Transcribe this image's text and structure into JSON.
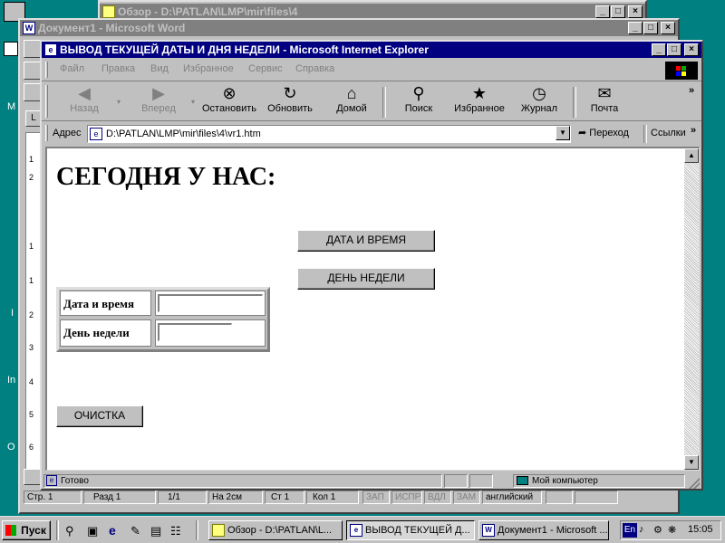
{
  "explorer_window": {
    "title": "Обзор - D:\\PATLAN\\LMP\\mir\\files\\4"
  },
  "word_window": {
    "title": "Документ1 - Microsoft Word",
    "status": {
      "page": "Стр. 1",
      "section": "Разд 1",
      "pages": "1/1",
      "position": "На 2см",
      "line": "Ст 1",
      "column": "Кол 1",
      "rec": "ЗАП",
      "trk": "ИСПР",
      "ext": "ВДЛ",
      "ovr": "ЗАМ",
      "language": "английский"
    },
    "ruler": [
      "1",
      "2",
      "1",
      "1",
      "2",
      "3",
      "4",
      "5",
      "6"
    ]
  },
  "ie_window": {
    "title": "ВЫВОД ТЕКУЩЕЙ ДАТЫ И ДНЯ НЕДЕЛИ - Microsoft Internet Explorer",
    "menu": [
      "Файл",
      "Правка",
      "Вид",
      "Избранное",
      "Сервис",
      "Справка"
    ],
    "toolbar": {
      "back": "Назад",
      "forward": "Вперед",
      "stop": "Остановить",
      "refresh": "Обновить",
      "home": "Домой",
      "search": "Поиск",
      "favorites": "Избранное",
      "history": "Журнал",
      "mail": "Почта"
    },
    "address": {
      "label": "Адрес",
      "value": "D:\\PATLAN\\LMP\\mir\\files\\4\\vr1.htm",
      "go": "Переход",
      "links": "Ссылки"
    },
    "page": {
      "heading": "СЕГОДНЯ У НАС:",
      "btn_datetime": "ДАТА И ВРЕМЯ",
      "btn_weekday": "ДЕНЬ НЕДЕЛИ",
      "row1_label": "Дата и время",
      "row1_value": "",
      "row2_label": "День недели",
      "row2_value": "",
      "btn_clear": "ОЧИСТКА"
    },
    "status": {
      "text": "Готово",
      "zone": "Мой компьютер"
    }
  },
  "taskbar": {
    "start": "Пуск",
    "tasks": [
      "Обзор - D:\\PATLAN\\L...",
      "ВЫВОД ТЕКУЩЕЙ Д...",
      "Документ1 - Microsoft ..."
    ],
    "lang": "En",
    "clock": "15:05"
  },
  "desktop": {
    "left_labels": [
      "M",
      "I",
      "In",
      "O"
    ]
  }
}
